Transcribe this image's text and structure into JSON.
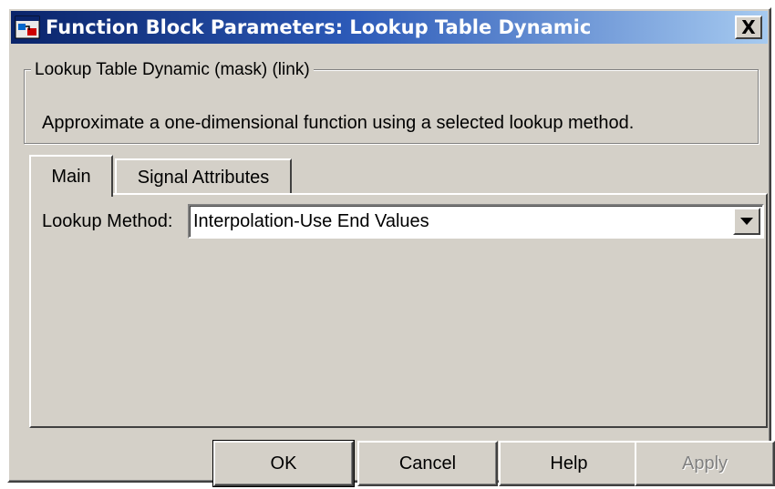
{
  "window": {
    "title": "Function Block Parameters: Lookup Table Dynamic",
    "close_label": "X"
  },
  "group": {
    "legend": "Lookup Table Dynamic (mask) (link)",
    "description": "Approximate a one-dimensional function using a selected lookup method."
  },
  "tabs": [
    {
      "label": "Main",
      "selected": true
    },
    {
      "label": "Signal Attributes",
      "selected": false
    }
  ],
  "main": {
    "lookup_method_label": "Lookup Method:",
    "lookup_method_value": "Interpolation-Use End Values"
  },
  "buttons": {
    "ok": "OK",
    "cancel": "Cancel",
    "help": "Help",
    "apply": "Apply"
  },
  "colors": {
    "title_gradient_start": "#0a246a",
    "title_gradient_end": "#a6caf0",
    "dialog_face": "#d4d0c8",
    "disabled_text": "#808080"
  },
  "icons": {
    "app": "simulink-block-icon",
    "close": "close-icon",
    "dropdown": "dropdown-arrow-icon"
  }
}
